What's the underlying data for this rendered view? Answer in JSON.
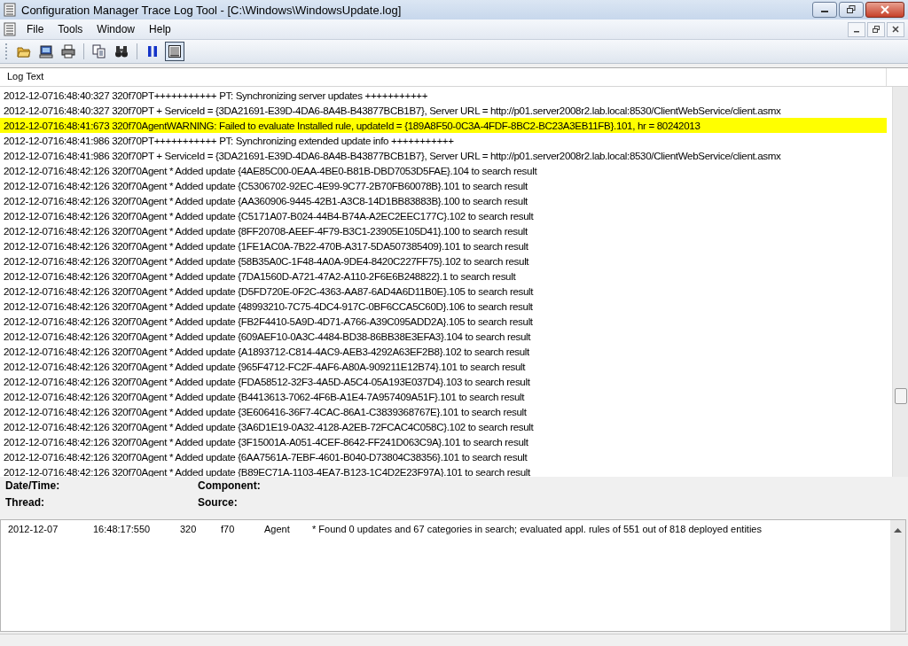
{
  "window": {
    "title": "Configuration Manager Trace Log Tool - [C:\\Windows\\WindowsUpdate.log]"
  },
  "menu": [
    "File",
    "Tools",
    "Window",
    "Help"
  ],
  "toolbar": [
    {
      "kind": "open",
      "selected": false
    },
    {
      "kind": "computer",
      "selected": false
    },
    {
      "kind": "print",
      "selected": false
    },
    {
      "kind": "copy",
      "selected": false
    },
    {
      "kind": "find",
      "selected": false
    },
    {
      "kind": "pause",
      "selected": false
    },
    {
      "kind": "details",
      "selected": true
    }
  ],
  "log": {
    "header": "Log Text",
    "rows": [
      {
        "text": "2012-12-0716:48:40:327 320f70PT+++++++++++  PT: Synchronizing server updates  +++++++++++",
        "highlighted": false
      },
      {
        "text": "2012-12-0716:48:40:327 320f70PT  + ServiceId = {3DA21691-E39D-4DA6-8A4B-B43877BCB1B7}, Server URL = http://p01.server2008r2.lab.local:8530/ClientWebService/client.asmx",
        "highlighted": false
      },
      {
        "text": "2012-12-0716:48:41:673 320f70AgentWARNING: Failed to evaluate Installed rule, updateId = {189A8F50-0C3A-4FDF-8BC2-BC23A3EB11FB}.101, hr = 80242013",
        "highlighted": true
      },
      {
        "text": "2012-12-0716:48:41:986 320f70PT+++++++++++  PT: Synchronizing extended update info  +++++++++++",
        "highlighted": false
      },
      {
        "text": "2012-12-0716:48:41:986 320f70PT  + ServiceId = {3DA21691-E39D-4DA6-8A4B-B43877BCB1B7}, Server URL = http://p01.server2008r2.lab.local:8530/ClientWebService/client.asmx",
        "highlighted": false
      },
      {
        "text": "2012-12-0716:48:42:126 320f70Agent  * Added update {4AE85C00-0EAA-4BE0-B81B-DBD7053D5FAE}.104 to search result",
        "highlighted": false
      },
      {
        "text": "2012-12-0716:48:42:126 320f70Agent  * Added update {C5306702-92EC-4E99-9C77-2B70FB60078B}.101 to search result",
        "highlighted": false
      },
      {
        "text": "2012-12-0716:48:42:126 320f70Agent  * Added update {AA360906-9445-42B1-A3C8-14D1BB83883B}.100 to search result",
        "highlighted": false
      },
      {
        "text": "2012-12-0716:48:42:126 320f70Agent  * Added update {C5171A07-B024-44B4-B74A-A2EC2EEC177C}.102 to search result",
        "highlighted": false
      },
      {
        "text": "2012-12-0716:48:42:126 320f70Agent  * Added update {8FF20708-AEEF-4F79-B3C1-23905E105D41}.100 to search result",
        "highlighted": false
      },
      {
        "text": "2012-12-0716:48:42:126 320f70Agent  * Added update {1FE1AC0A-7B22-470B-A317-5DA507385409}.101 to search result",
        "highlighted": false
      },
      {
        "text": "2012-12-0716:48:42:126 320f70Agent  * Added update {58B35A0C-1F48-4A0A-9DE4-8420C227FF75}.102 to search result",
        "highlighted": false
      },
      {
        "text": "2012-12-0716:48:42:126 320f70Agent  * Added update {7DA1560D-A721-47A2-A110-2F6E6B248822}.1 to search result",
        "highlighted": false
      },
      {
        "text": "2012-12-0716:48:42:126 320f70Agent  * Added update {D5FD720E-0F2C-4363-AA87-6AD4A6D11B0E}.105 to search result",
        "highlighted": false
      },
      {
        "text": "2012-12-0716:48:42:126 320f70Agent  * Added update {48993210-7C75-4DC4-917C-0BF6CCA5C60D}.106 to search result",
        "highlighted": false
      },
      {
        "text": "2012-12-0716:48:42:126 320f70Agent  * Added update {FB2F4410-5A9D-4D71-A766-A39C095ADD2A}.105 to search result",
        "highlighted": false
      },
      {
        "text": "2012-12-0716:48:42:126 320f70Agent  * Added update {609AEF10-0A3C-4484-BD38-86BB38E3EFA3}.104 to search result",
        "highlighted": false
      },
      {
        "text": "2012-12-0716:48:42:126 320f70Agent  * Added update {A1893712-C814-4AC9-AEB3-4292A63EF2B8}.102 to search result",
        "highlighted": false
      },
      {
        "text": "2012-12-0716:48:42:126 320f70Agent  * Added update {965F4712-FC2F-4AF6-A80A-909211E12B74}.101 to search result",
        "highlighted": false
      },
      {
        "text": "2012-12-0716:48:42:126 320f70Agent  * Added update {FDA58512-32F3-4A5D-A5C4-05A193E037D4}.103 to search result",
        "highlighted": false
      },
      {
        "text": "2012-12-0716:48:42:126 320f70Agent  * Added update {B4413613-7062-4F6B-A1E4-7A957409A51F}.101 to search result",
        "highlighted": false
      },
      {
        "text": "2012-12-0716:48:42:126 320f70Agent  * Added update {3E606416-36F7-4CAC-86A1-C3839368767E}.101 to search result",
        "highlighted": false
      },
      {
        "text": "2012-12-0716:48:42:126 320f70Agent  * Added update {3A6D1E19-0A32-4128-A2EB-72FCAC4C058C}.102 to search result",
        "highlighted": false
      },
      {
        "text": "2012-12-0716:48:42:126 320f70Agent  * Added update {3F15001A-A051-4CEF-8642-FF241D063C9A}.101 to search result",
        "highlighted": false
      },
      {
        "text": "2012-12-0716:48:42:126 320f70Agent  * Added update {6AA7561A-7EBF-4601-B040-D73804C38356}.101 to search result",
        "highlighted": false
      },
      {
        "text": "2012-12-0716:48:42:126 320f70Agent  * Added update {B89EC71A-1103-4EA7-B123-1C4D2E23F97A}.101 to search result",
        "highlighted": false
      }
    ]
  },
  "details": [
    {
      "label": "Date/Time:"
    },
    {
      "label": "Component:"
    },
    {
      "label": "Thread:"
    },
    {
      "label": "Source:"
    }
  ],
  "entries": [
    {
      "date": "2012-12-07",
      "time": "16:48:17:550",
      "process": "320",
      "thread": "f70",
      "component": "Agent",
      "message": "* Found 0 updates and 67 categories in search; evaluated appl. rules of 551 out of 818 deployed entities"
    }
  ]
}
